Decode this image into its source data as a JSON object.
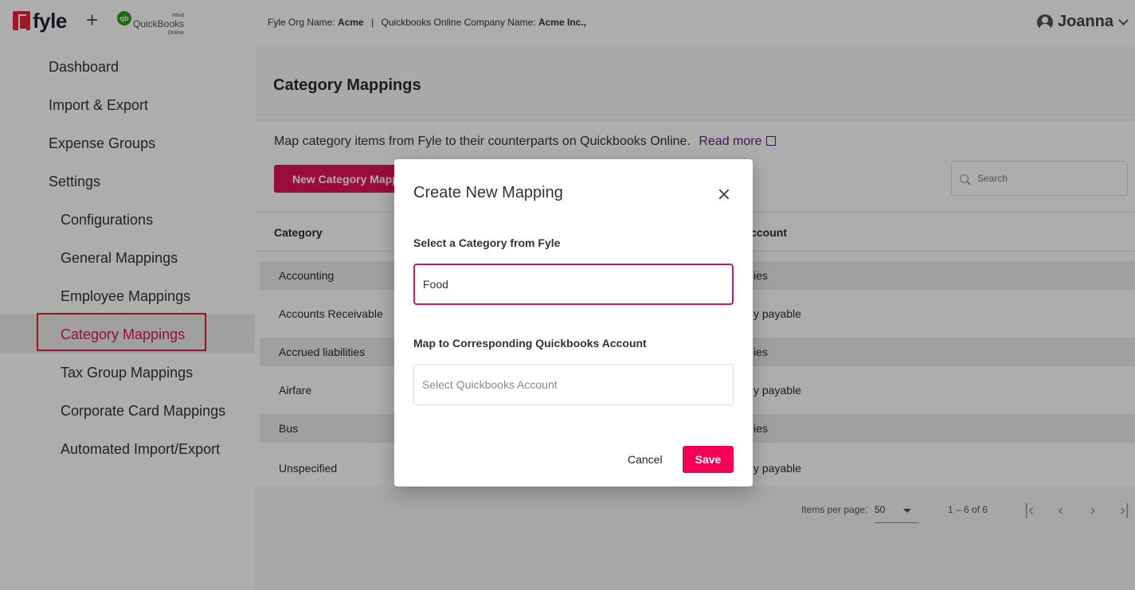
{
  "header": {
    "brand_name": "fyle",
    "plus": "+",
    "qb_logo_mark": "qb",
    "qb_logo_intuit": "intuit",
    "qb_logo_name": "QuickBooks",
    "qb_logo_sub": "Online",
    "org_label": "Fyle Org Name:",
    "org_value": "Acme",
    "separator": "|",
    "company_label": "Quickbooks Online Company Name:",
    "company_value": "Acme Inc.,",
    "user_name": "Joanna",
    "user_icon": "account-circle-icon"
  },
  "sidebar": {
    "items": [
      {
        "label": "Dashboard"
      },
      {
        "label": "Import & Export"
      },
      {
        "label": "Expense Groups"
      },
      {
        "label": "Settings"
      },
      {
        "label": "Configurations"
      },
      {
        "label": "General Mappings"
      },
      {
        "label": "Employee Mappings"
      },
      {
        "label": "Category Mappings"
      },
      {
        "label": "Tax Group Mappings"
      },
      {
        "label": "Corporate Card Mappings"
      },
      {
        "label": "Automated Import/Export"
      }
    ],
    "active_index": 7,
    "active_color": "#e2125a"
  },
  "main": {
    "page_title": "Category Mappings",
    "description": "Map category items from Fyle to their counterparts on Quickbooks Online.",
    "read_more": "Read more",
    "new_button": "New Category Mapping",
    "search_placeholder": "Search",
    "table": {
      "headers": [
        "Category",
        "Account"
      ],
      "rows": [
        {
          "category": "Accounting",
          "account": "ies"
        },
        {
          "category": "Accounts Receivable",
          "account": "y payable"
        },
        {
          "category": "Accrued liabilities",
          "account": "ies"
        },
        {
          "category": "Airfare",
          "account": "y payable"
        },
        {
          "category": "Bus",
          "account": "ies"
        },
        {
          "category": "Unspecified",
          "account": "y payable"
        }
      ]
    },
    "paginator": {
      "items_per_page_label": "Items per page:",
      "items_per_page_value": "50",
      "range": "1 – 6 of 6"
    }
  },
  "dialog": {
    "title": "Create New Mapping",
    "fyle_label": "Select a Category from Fyle",
    "fyle_value": "Food",
    "qb_label": "Map to Corresponding Quickbooks Account",
    "qb_placeholder": "Select Quickbooks Account",
    "cancel": "Cancel",
    "save": "Save",
    "save_color": "#f50057"
  }
}
